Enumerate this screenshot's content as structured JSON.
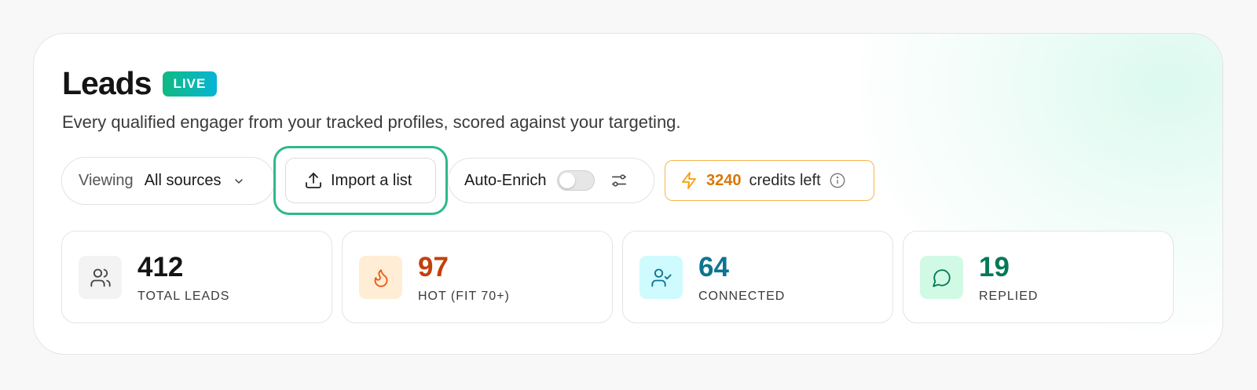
{
  "header": {
    "title": "Leads",
    "badge": "LIVE",
    "subtitle": "Every qualified engager from your tracked profiles, scored against your targeting."
  },
  "toolbar": {
    "viewing_label": "Viewing",
    "viewing_value": "All sources",
    "import_label": "Import a list",
    "auto_enrich_label": "Auto-Enrich",
    "auto_enrich_on": false,
    "credits_value": "3240",
    "credits_label": "credits left"
  },
  "stats": [
    {
      "value": "412",
      "label": "TOTAL LEADS",
      "icon": "users-icon",
      "color": "#141414",
      "bg": "#f3f3f3"
    },
    {
      "value": "97",
      "label": "HOT (FIT 70+)",
      "icon": "flame-icon",
      "color": "#c2410c",
      "bg": "#ffedd5"
    },
    {
      "value": "64",
      "label": "CONNECTED",
      "icon": "user-check-icon",
      "color": "#0e7490",
      "bg": "#cffafe"
    },
    {
      "value": "19",
      "label": "REPLIED",
      "icon": "message-circle-icon",
      "color": "#047857",
      "bg": "#d1fae5"
    }
  ],
  "colors": {
    "accent": "#2fb98a",
    "credits": "#d97706",
    "badge_gradient": [
      "#10b981",
      "#06b6d4"
    ]
  }
}
